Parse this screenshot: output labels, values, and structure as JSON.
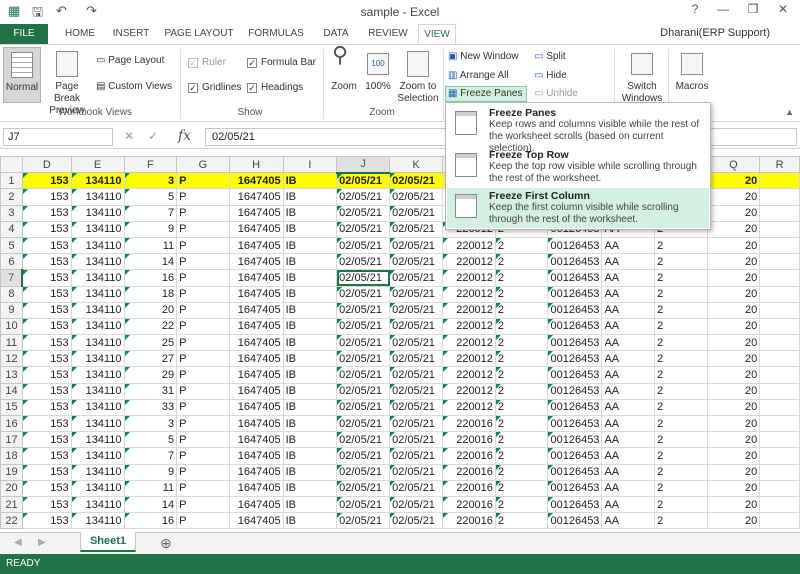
{
  "window": {
    "title": "sample - Excel",
    "help": "?",
    "minimize": "—",
    "restore": "❐",
    "close": "✕",
    "user": "Dharani(ERP Support)"
  },
  "tabs": [
    "FILE",
    "HOME",
    "INSERT",
    "PAGE LAYOUT",
    "FORMULAS",
    "DATA",
    "REVIEW",
    "VIEW"
  ],
  "ribbon": {
    "normal": "Normal",
    "page_break": "Page Break Preview",
    "page_layout": "Page Layout",
    "custom_views": "Custom Views",
    "group_workbook_views": "Workbook Views",
    "ruler": "Ruler",
    "formula_bar": "Formula Bar",
    "gridlines": "Gridlines",
    "headings": "Headings",
    "group_show": "Show",
    "zoom": "Zoom",
    "zoom100": "100%",
    "zoom_selection": "Zoom to Selection",
    "group_zoom": "Zoom",
    "new_window": "New Window",
    "arrange_all": "Arrange All",
    "freeze_panes": "Freeze Panes",
    "split": "Split",
    "hide": "Hide",
    "unhide": "Unhide",
    "switch_windows": "Switch Windows",
    "macros": "Macros"
  },
  "formula_bar": {
    "name_box": "J7",
    "fx": "fx",
    "value": "02/05/21"
  },
  "freeze_menu": [
    {
      "title": "Freeze Panes",
      "desc": "Keep rows and columns visible while the rest of the worksheet scrolls (based on current selection)."
    },
    {
      "title": "Freeze Top Row",
      "desc": "Keep the top row visible while scrolling through the rest of the worksheet."
    },
    {
      "title": "Freeze First Column",
      "desc": "Keep the first column visible while scrolling through the rest of the worksheet."
    }
  ],
  "grid": {
    "columns": [
      "D",
      "E",
      "F",
      "G",
      "H",
      "I",
      "J",
      "K",
      "L",
      "M",
      "N",
      "O",
      "P",
      "Q",
      "R"
    ],
    "rows": [
      [
        "1",
        "153",
        "134110",
        "3",
        "P",
        "1647405",
        "IB",
        "02/05/21",
        "02/05/21",
        "",
        "",
        "",
        "",
        "",
        "20",
        ""
      ],
      [
        "2",
        "153",
        "134110",
        "5",
        "P",
        "1647405",
        "IB",
        "02/05/21",
        "02/05/21",
        "",
        "",
        "",
        "",
        "",
        "20",
        ""
      ],
      [
        "3",
        "153",
        "134110",
        "7",
        "P",
        "1647405",
        "IB",
        "02/05/21",
        "02/05/21",
        "",
        "",
        "",
        "",
        "",
        "20",
        ""
      ],
      [
        "4",
        "153",
        "134110",
        "9",
        "P",
        "1647405",
        "IB",
        "02/05/21",
        "02/05/21",
        "220012",
        "2",
        "00126453",
        "AA",
        "2",
        "20",
        ""
      ],
      [
        "5",
        "153",
        "134110",
        "11",
        "P",
        "1647405",
        "IB",
        "02/05/21",
        "02/05/21",
        "220012",
        "2",
        "00126453",
        "AA",
        "2",
        "20",
        ""
      ],
      [
        "6",
        "153",
        "134110",
        "14",
        "P",
        "1647405",
        "IB",
        "02/05/21",
        "02/05/21",
        "220012",
        "2",
        "00126453",
        "AA",
        "2",
        "20",
        ""
      ],
      [
        "7",
        "153",
        "134110",
        "16",
        "P",
        "1647405",
        "IB",
        "02/05/21",
        "02/05/21",
        "220012",
        "2",
        "00126453",
        "AA",
        "2",
        "20",
        ""
      ],
      [
        "8",
        "153",
        "134110",
        "18",
        "P",
        "1647405",
        "IB",
        "02/05/21",
        "02/05/21",
        "220012",
        "2",
        "00126453",
        "AA",
        "2",
        "20",
        ""
      ],
      [
        "9",
        "153",
        "134110",
        "20",
        "P",
        "1647405",
        "IB",
        "02/05/21",
        "02/05/21",
        "220012",
        "2",
        "00126453",
        "AA",
        "2",
        "20",
        ""
      ],
      [
        "10",
        "153",
        "134110",
        "22",
        "P",
        "1647405",
        "IB",
        "02/05/21",
        "02/05/21",
        "220012",
        "2",
        "00126453",
        "AA",
        "2",
        "20",
        ""
      ],
      [
        "11",
        "153",
        "134110",
        "25",
        "P",
        "1647405",
        "IB",
        "02/05/21",
        "02/05/21",
        "220012",
        "2",
        "00126453",
        "AA",
        "2",
        "20",
        ""
      ],
      [
        "12",
        "153",
        "134110",
        "27",
        "P",
        "1647405",
        "IB",
        "02/05/21",
        "02/05/21",
        "220012",
        "2",
        "00126453",
        "AA",
        "2",
        "20",
        ""
      ],
      [
        "13",
        "153",
        "134110",
        "29",
        "P",
        "1647405",
        "IB",
        "02/05/21",
        "02/05/21",
        "220012",
        "2",
        "00126453",
        "AA",
        "2",
        "20",
        ""
      ],
      [
        "14",
        "153",
        "134110",
        "31",
        "P",
        "1647405",
        "IB",
        "02/05/21",
        "02/05/21",
        "220012",
        "2",
        "00126453",
        "AA",
        "2",
        "20",
        ""
      ],
      [
        "15",
        "153",
        "134110",
        "33",
        "P",
        "1647405",
        "IB",
        "02/05/21",
        "02/05/21",
        "220012",
        "2",
        "00126453",
        "AA",
        "2",
        "20",
        ""
      ],
      [
        "16",
        "153",
        "134110",
        "3",
        "P",
        "1647405",
        "IB",
        "02/05/21",
        "02/05/21",
        "220016",
        "2",
        "00126453",
        "AA",
        "2",
        "20",
        ""
      ],
      [
        "17",
        "153",
        "134110",
        "5",
        "P",
        "1647405",
        "IB",
        "02/05/21",
        "02/05/21",
        "220016",
        "2",
        "00126453",
        "AA",
        "2",
        "20",
        ""
      ],
      [
        "18",
        "153",
        "134110",
        "7",
        "P",
        "1647405",
        "IB",
        "02/05/21",
        "02/05/21",
        "220016",
        "2",
        "00126453",
        "AA",
        "2",
        "20",
        ""
      ],
      [
        "19",
        "153",
        "134110",
        "9",
        "P",
        "1647405",
        "IB",
        "02/05/21",
        "02/05/21",
        "220016",
        "2",
        "00126453",
        "AA",
        "2",
        "20",
        ""
      ],
      [
        "20",
        "153",
        "134110",
        "11",
        "P",
        "1647405",
        "IB",
        "02/05/21",
        "02/05/21",
        "220016",
        "2",
        "00126453",
        "AA",
        "2",
        "20",
        ""
      ],
      [
        "21",
        "153",
        "134110",
        "14",
        "P",
        "1647405",
        "IB",
        "02/05/21",
        "02/05/21",
        "220016",
        "2",
        "00126453",
        "AA",
        "2",
        "20",
        ""
      ],
      [
        "22",
        "153",
        "134110",
        "16",
        "P",
        "1647405",
        "IB",
        "02/05/21",
        "02/05/21",
        "220016",
        "2",
        "00126453",
        "AA",
        "2",
        "20",
        ""
      ]
    ]
  },
  "sheet_tab": "Sheet1",
  "add_sheet": "⊕",
  "status": "READY",
  "colors": {
    "accent": "#217346",
    "highlight": "#ffff00"
  }
}
